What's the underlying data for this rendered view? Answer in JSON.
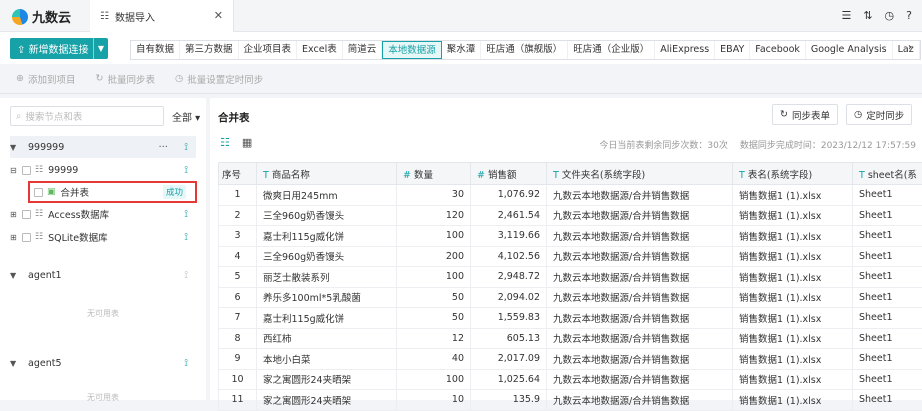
{
  "app": {
    "logo_text": "九数云",
    "tab_label": "数据导入",
    "tab_icon": "database-icon",
    "close_glyph": "✕"
  },
  "top_icons": [
    "list-icon",
    "sort-icon",
    "clock-icon",
    "help-icon"
  ],
  "toolbar": {
    "add_label": "新增数据连接",
    "sources": [
      "自有数据",
      "第三方数据",
      "企业项目表",
      "Excel表",
      "简道云",
      "本地数据源",
      "聚水潭",
      "旺店通（旗舰版）",
      "旺店通（企业版）",
      "AliExpress",
      "EBAY",
      "Facebook",
      "Google Analysis",
      "Laz"
    ],
    "active_source": "本地数据源"
  },
  "actions": {
    "add_item": "添加到项目",
    "batch_sync": "批量同步表",
    "batch_time": "批量设置定时同步"
  },
  "sidebar": {
    "search_placeholder": "搜索节点和表",
    "all_label": "全部",
    "groups": [
      {
        "name": "999999",
        "items": [
          {
            "label": "99999"
          },
          {
            "label": "合并表",
            "badge": "成功",
            "selected": true
          },
          {
            "label": "Access数据库"
          },
          {
            "label": "SQLite数据库"
          }
        ]
      },
      {
        "name": "agent1",
        "empty": "无可用表"
      },
      {
        "name": "agent5",
        "empty": "无可用表"
      }
    ]
  },
  "main": {
    "title": "合并表",
    "sync_table": "同步表单",
    "timed_sync": "定时同步",
    "remaining": "今日当前表剩余同步次数：30次",
    "finish_time": "数据同步完成时间：2023/12/12 17:57:59",
    "columns": [
      {
        "type": "",
        "name": "序号"
      },
      {
        "type": "T",
        "name": "商品名称"
      },
      {
        "type": "#",
        "name": "数量"
      },
      {
        "type": "#",
        "name": "销售额"
      },
      {
        "type": "T",
        "name": "文件夹名(系统字段)"
      },
      {
        "type": "T",
        "name": "表名(系统字段)"
      },
      {
        "type": "T",
        "name": "sheet名(系"
      }
    ],
    "rows": [
      [
        "1",
        "微爽日用245mm",
        "30",
        "1,076.92",
        "九数云本地数据源/合并销售数据",
        "销售数据1 (1).xlsx",
        "Sheet1"
      ],
      [
        "2",
        "三全960g奶香馒头",
        "120",
        "2,461.54",
        "九数云本地数据源/合并销售数据",
        "销售数据1 (1).xlsx",
        "Sheet1"
      ],
      [
        "3",
        "嘉士利115g威化饼",
        "100",
        "3,119.66",
        "九数云本地数据源/合并销售数据",
        "销售数据1 (1).xlsx",
        "Sheet1"
      ],
      [
        "4",
        "三全960g奶香馒头",
        "200",
        "4,102.56",
        "九数云本地数据源/合并销售数据",
        "销售数据1 (1).xlsx",
        "Sheet1"
      ],
      [
        "5",
        "丽芝士散装系列",
        "100",
        "2,948.72",
        "九数云本地数据源/合并销售数据",
        "销售数据1 (1).xlsx",
        "Sheet1"
      ],
      [
        "6",
        "养乐多100ml*5乳酸菌",
        "50",
        "2,094.02",
        "九数云本地数据源/合并销售数据",
        "销售数据1 (1).xlsx",
        "Sheet1"
      ],
      [
        "7",
        "嘉士利115g威化饼",
        "50",
        "1,559.83",
        "九数云本地数据源/合并销售数据",
        "销售数据1 (1).xlsx",
        "Sheet1"
      ],
      [
        "8",
        "西红柿",
        "12",
        "605.13",
        "九数云本地数据源/合并销售数据",
        "销售数据1 (1).xlsx",
        "Sheet1"
      ],
      [
        "9",
        "本地小白菜",
        "40",
        "2,017.09",
        "九数云本地数据源/合并销售数据",
        "销售数据1 (1).xlsx",
        "Sheet1"
      ],
      [
        "10",
        "家之寓圆形24夹晒架",
        "100",
        "1,025.64",
        "九数云本地数据源/合并销售数据",
        "销售数据1 (1).xlsx",
        "Sheet1"
      ],
      [
        "11",
        "家之寓圆形24夹晒架",
        "10",
        "135.9",
        "九数云本地数据源/合并销售数据",
        "销售数据1 (1).xlsx",
        "Sheet1"
      ]
    ]
  }
}
